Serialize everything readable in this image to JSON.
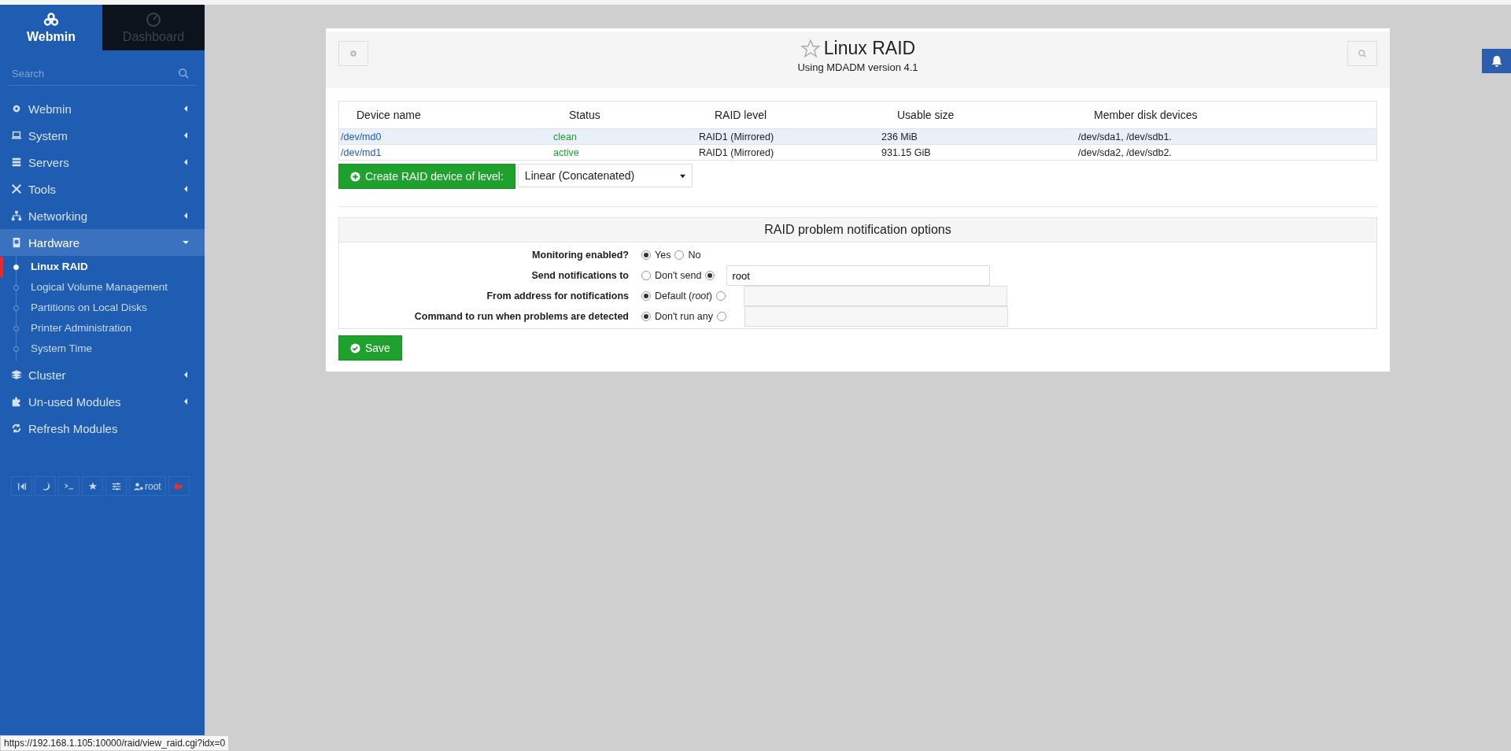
{
  "sidebar": {
    "tabs": [
      {
        "label": "Webmin",
        "selected": true
      },
      {
        "label": "Dashboard",
        "selected": false
      }
    ],
    "search": {
      "placeholder": "Search"
    },
    "menu": [
      {
        "label": "Webmin",
        "kind": "category",
        "expanded": false
      },
      {
        "label": "System",
        "kind": "category",
        "expanded": false
      },
      {
        "label": "Servers",
        "kind": "category",
        "expanded": false
      },
      {
        "label": "Tools",
        "kind": "category",
        "expanded": false
      },
      {
        "label": "Networking",
        "kind": "category",
        "expanded": false
      },
      {
        "label": "Hardware",
        "kind": "category",
        "expanded": true,
        "children": [
          {
            "label": "Linux RAID",
            "selected": true
          },
          {
            "label": "Logical Volume Management",
            "selected": false
          },
          {
            "label": "Partitions on Local Disks",
            "selected": false
          },
          {
            "label": "Printer Administration",
            "selected": false
          },
          {
            "label": "System Time",
            "selected": false
          }
        ]
      },
      {
        "label": "Cluster",
        "kind": "category",
        "expanded": false
      },
      {
        "label": "Un-used Modules",
        "kind": "category",
        "expanded": false
      },
      {
        "label": "Refresh Modules",
        "kind": "action",
        "expanded": false
      }
    ],
    "toolbar_user": "root"
  },
  "page": {
    "title": "Linux RAID",
    "subtitle": "Using MDADM version 4.1"
  },
  "table": {
    "columns": [
      "Device name",
      "Status",
      "RAID level",
      "Usable size",
      "Member disk devices"
    ],
    "rows": [
      {
        "device": "/dev/md0",
        "status": "clean",
        "level": "RAID1 (Mirrored)",
        "size": "236 MiB",
        "members": "/dev/sda1, /dev/sdb1.",
        "selected": true
      },
      {
        "device": "/dev/md1",
        "status": "active",
        "level": "RAID1 (Mirrored)",
        "size": "931.15 GiB",
        "members": "/dev/sda2, /dev/sdb2.",
        "selected": false
      }
    ]
  },
  "create": {
    "button": "Create RAID device of level:",
    "value": "Linear (Concatenated)"
  },
  "notifications": {
    "title": "RAID problem notification options",
    "rows": [
      {
        "label": "Monitoring enabled?",
        "options": [
          {
            "kind": "text",
            "label": "Yes",
            "selected": true
          },
          {
            "kind": "text",
            "label": "No",
            "selected": false
          }
        ]
      },
      {
        "label": "Send notifications to",
        "options": [
          {
            "kind": "text",
            "label": "Don't send",
            "selected": false
          },
          {
            "kind": "field",
            "value": "root",
            "selected": true
          }
        ]
      },
      {
        "label": "From address for notifications",
        "options": [
          {
            "kind": "text",
            "label": "Default (*root*)",
            "selected": true
          },
          {
            "kind": "field",
            "selected": false
          }
        ]
      },
      {
        "label": "Command to run when problems are detected",
        "options": [
          {
            "kind": "text",
            "label": "Don't run any",
            "selected": true
          },
          {
            "kind": "field",
            "selected": false
          }
        ]
      }
    ]
  },
  "save": "Save",
  "status_url": "https://192.168.1.105:10000/raid/view_raid.cgi?idx=0"
}
